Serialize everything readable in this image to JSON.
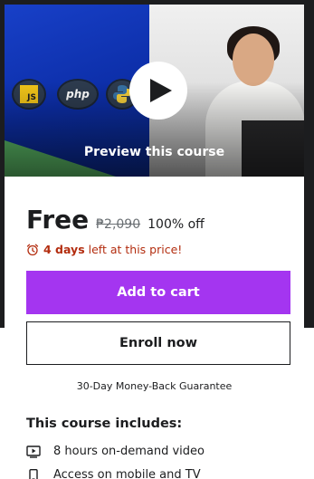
{
  "preview": {
    "label": "Preview this course",
    "badges": {
      "js": "JS",
      "php": "php"
    }
  },
  "pricing": {
    "current": "Free",
    "original": "₱2,090",
    "discount": "100% off"
  },
  "timer": {
    "bold": "4 days",
    "rest": " left at this price!"
  },
  "actions": {
    "add_to_cart": "Add to cart",
    "enroll_now": "Enroll now"
  },
  "guarantee": "30-Day Money-Back Guarantee",
  "includes": {
    "title": "This course includes:",
    "items": [
      {
        "icon": "video-icon",
        "text": "8 hours on-demand video"
      },
      {
        "icon": "mobile-icon",
        "text": "Access on mobile and TV"
      }
    ]
  },
  "colors": {
    "accent": "#a435f0",
    "urgency": "#b32d0f",
    "text": "#1c1d1f",
    "muted": "#6a6f73",
    "backdrop": "#1c1d1f"
  }
}
